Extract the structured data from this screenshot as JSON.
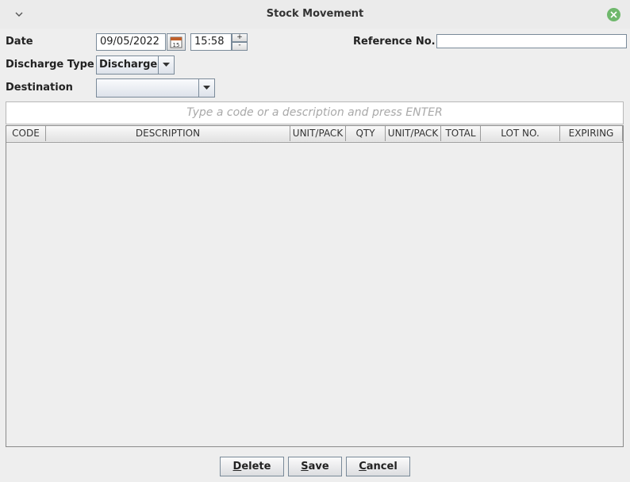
{
  "window": {
    "title": "Stock Movement",
    "menu_icon": "chevron-down-icon",
    "close_icon": "close-icon",
    "close_color": "#6fb86c"
  },
  "form": {
    "date_label": "Date",
    "date_value": "09/05/2022",
    "calendar_icon": "calendar-icon",
    "time_value": "15:58",
    "spinner_up": "+",
    "spinner_down": "-",
    "reference_label": "Reference No.",
    "reference_value": "",
    "discharge_type_label": "Discharge Type",
    "discharge_type_value": "Discharge",
    "destination_label": "Destination",
    "destination_value": ""
  },
  "search": {
    "placeholder": "Type a code or a description and press ENTER"
  },
  "table": {
    "columns": [
      "CODE",
      "DESCRIPTION",
      "UNIT/PACK",
      "QTY",
      "UNIT/PACK",
      "TOTAL",
      "LOT NO.",
      "EXPIRING"
    ],
    "rows": []
  },
  "buttons": {
    "delete": {
      "mnemonic": "D",
      "rest": "elete"
    },
    "save": {
      "mnemonic": "S",
      "rest": "ave"
    },
    "cancel": {
      "mnemonic": "C",
      "rest": "ancel"
    }
  }
}
